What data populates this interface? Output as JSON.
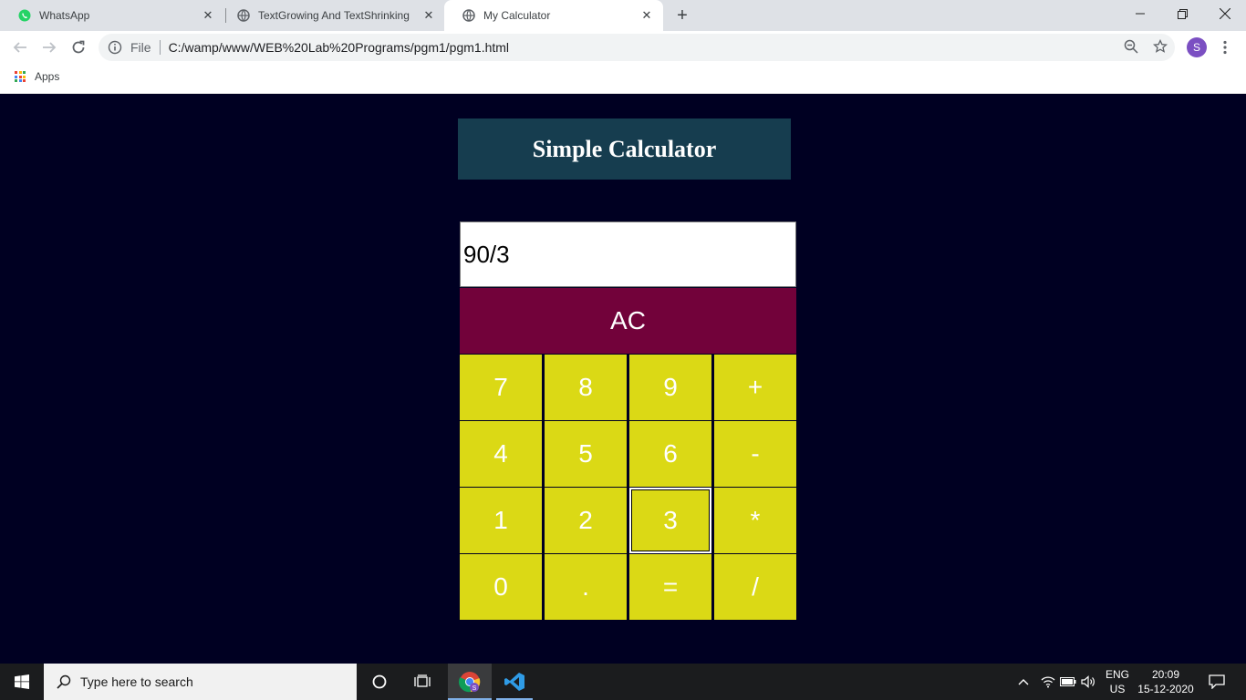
{
  "browser": {
    "tabs": [
      {
        "title": "WhatsApp",
        "active": false
      },
      {
        "title": "TextGrowing And TextShrinking",
        "active": false
      },
      {
        "title": "My Calculator",
        "active": true
      }
    ],
    "url": {
      "scheme_label": "File",
      "path": "C:/wamp/www/WEB%20Lab%20Programs/pgm1/pgm1.html"
    },
    "profile_initial": "S",
    "bookmarks": {
      "apps_label": "Apps"
    }
  },
  "calculator": {
    "title": "Simple Calculator",
    "display_value": "90/3",
    "clear_label": "AC",
    "keys": [
      [
        "7",
        "8",
        "9",
        "+"
      ],
      [
        "4",
        "5",
        "6",
        "-"
      ],
      [
        "1",
        "2",
        "3",
        "*"
      ],
      [
        "0",
        ".",
        "=",
        "/"
      ]
    ],
    "focused_key": "3"
  },
  "taskbar": {
    "search_placeholder": "Type here to search",
    "language": "ENG",
    "region": "US",
    "time": "20:09",
    "date": "15-12-2020"
  },
  "colors": {
    "page_background": "#000022",
    "title_background": "#163d4f",
    "clear_button": "#72023a",
    "key_button": "#dbd915"
  }
}
